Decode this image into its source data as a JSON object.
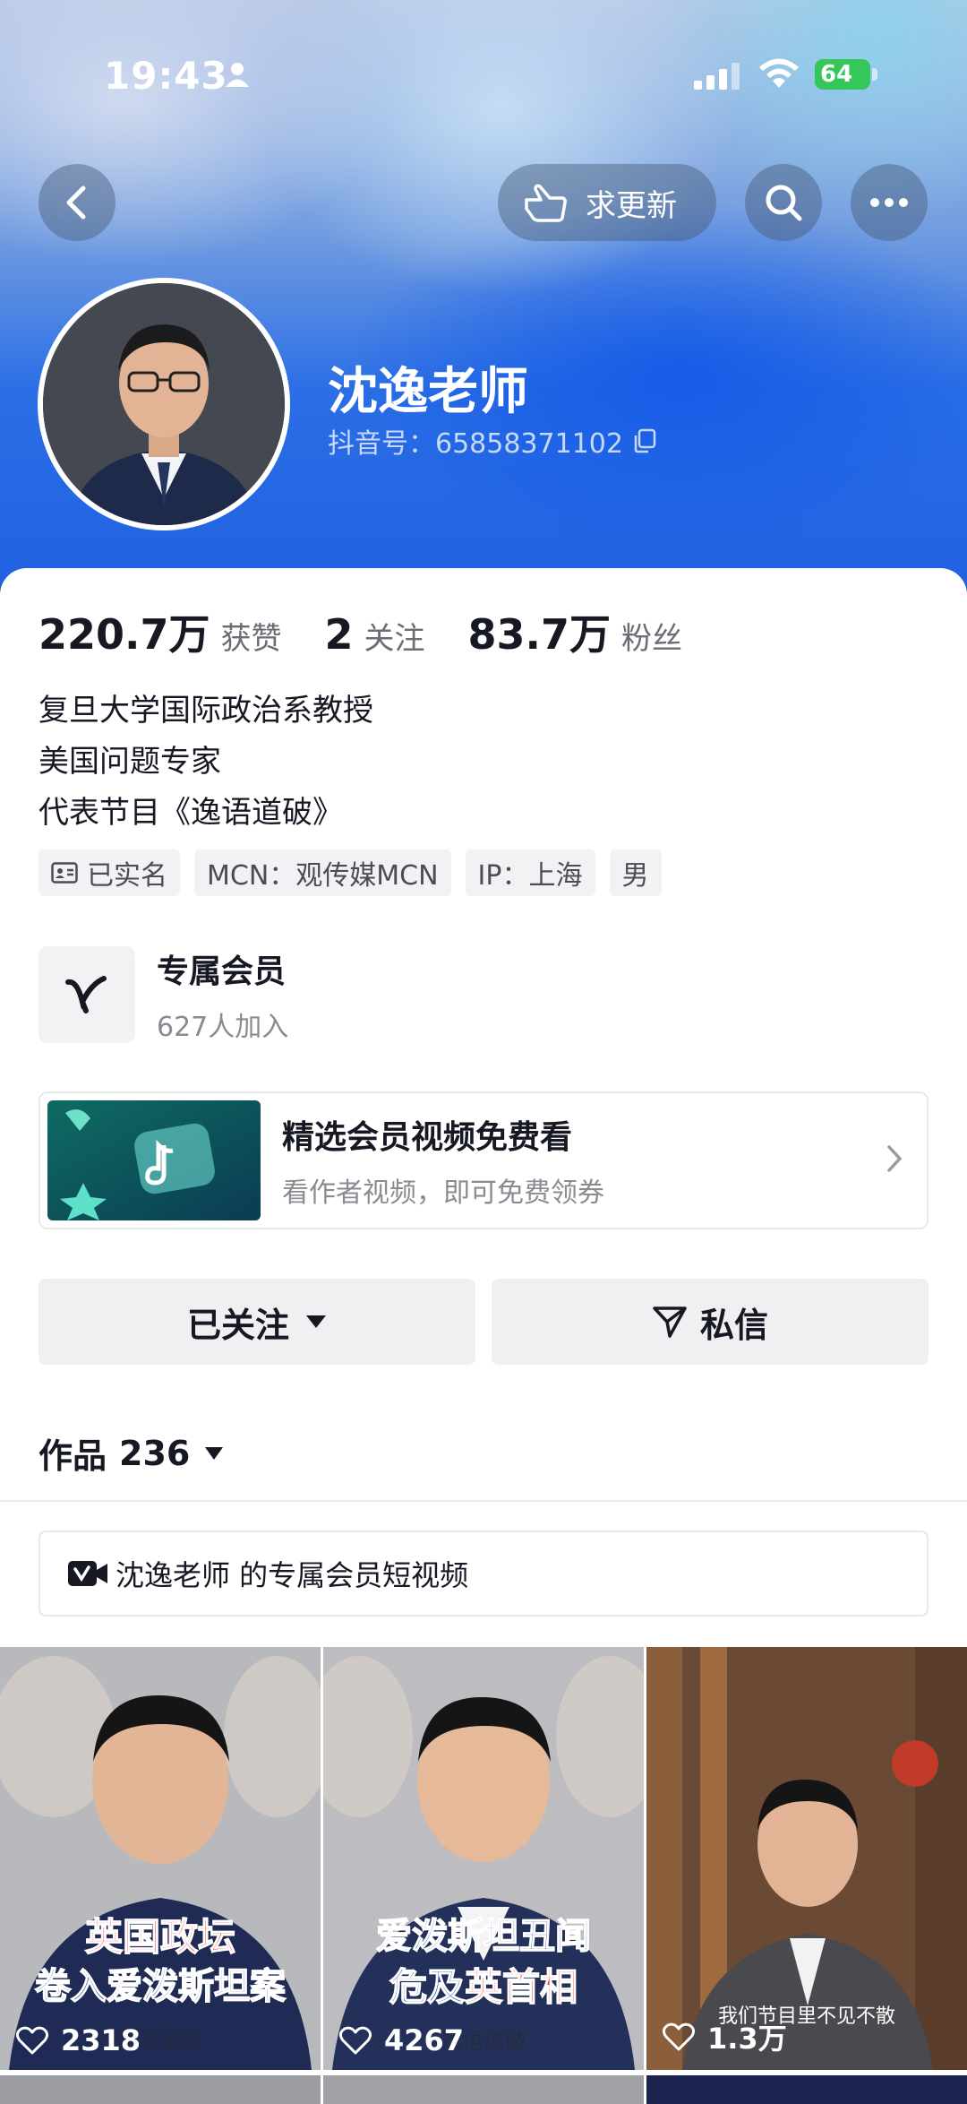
{
  "status_bar": {
    "time": "19:43",
    "battery": "64"
  },
  "top_actions": {
    "update_label": "求更新"
  },
  "profile": {
    "name": "沈逸老师",
    "douyin_id": "抖音号：65858371102"
  },
  "stats": [
    {
      "value": "220.7万",
      "label": "获赞"
    },
    {
      "value": "2",
      "label": "关注"
    },
    {
      "value": "83.7万",
      "label": "粉丝"
    }
  ],
  "bio": [
    "复旦大学国际政治系教授",
    "美国问题专家",
    "代表节目《逸语道破》"
  ],
  "tags": [
    "已实名",
    "MCN：观传媒MCN",
    "IP：上海",
    "男"
  ],
  "membership": {
    "title": "专属会员",
    "subtitle": "627人加入"
  },
  "promo": {
    "title": "精选会员视频免费看",
    "subtitle": "看作者视频，即可免费领券"
  },
  "buttons": {
    "follow": "已关注",
    "message": "私信"
  },
  "works": {
    "label": "作品",
    "count": "236"
  },
  "vip_bar": {
    "label": "沈逸老师 的专属会员短视频"
  },
  "videos": [
    {
      "caption_line1": "英国政坛",
      "caption_line2": "卷入爱泼斯坦案",
      "likes": "2318",
      "watermark": "逸语道破"
    },
    {
      "caption_line1": "爱泼斯坦丑闻",
      "caption_line2_a": "危及",
      "caption_line2_b": "英首相",
      "likes": "4267",
      "watermark": "逸语道破"
    },
    {
      "subtitle": "我们节目里不见不散",
      "likes": "1.3万"
    }
  ],
  "colors": {
    "accent_red": "#fe2c55",
    "brand_blue": "#1f5fe0",
    "battery_green": "#35c759"
  }
}
